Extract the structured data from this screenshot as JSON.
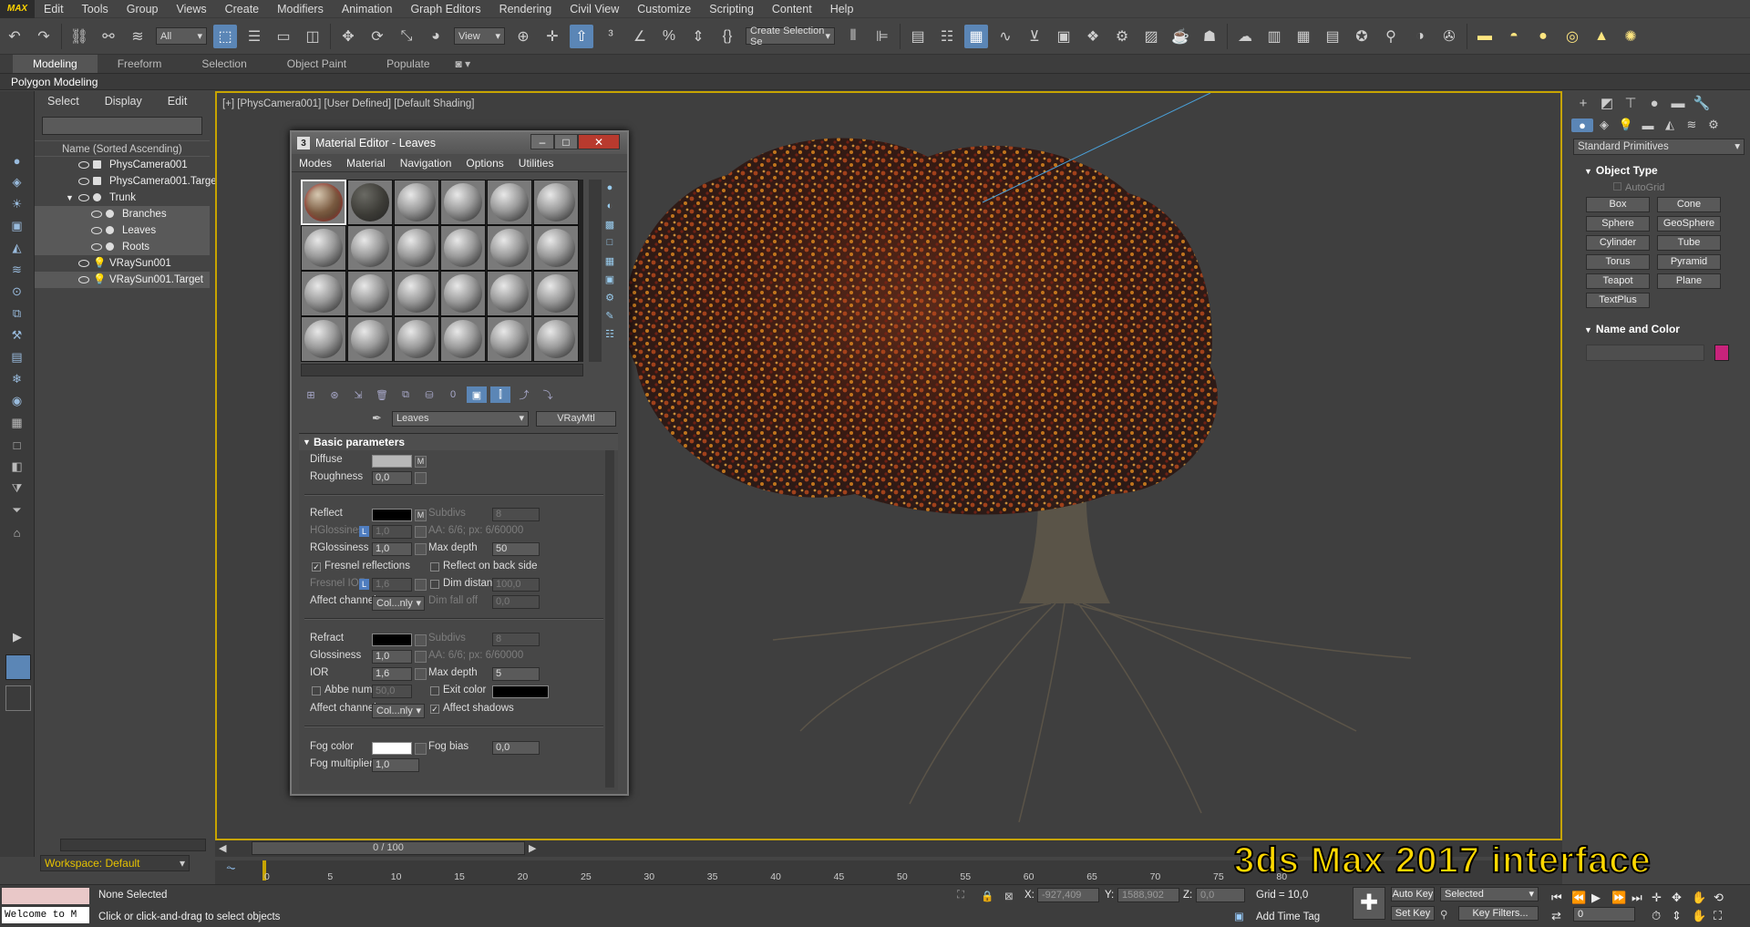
{
  "menu": {
    "logo": "MAX",
    "items": [
      "Edit",
      "Tools",
      "Group",
      "Views",
      "Create",
      "Modifiers",
      "Animation",
      "Graph Editors",
      "Rendering",
      "Civil View",
      "Customize",
      "Scripting",
      "Content",
      "Help"
    ]
  },
  "toolbar": {
    "filter": "All",
    "refcoord": "View",
    "selection_set": "Create Selection Se"
  },
  "ribbon": {
    "tabs": [
      "Modeling",
      "Freeform",
      "Selection",
      "Object Paint",
      "Populate"
    ],
    "sublabel": "Polygon Modeling"
  },
  "explorer": {
    "tabs": [
      "Select",
      "Display",
      "Edit"
    ],
    "header": "Name (Sorted Ascending)",
    "rows": [
      "PhysCamera001",
      "PhysCamera001.Target",
      "Trunk",
      "Branches",
      "Leaves",
      "Roots",
      "VRaySun001",
      "VRaySun001.Target"
    ]
  },
  "viewport": {
    "label": "[+] [PhysCamera001] [User Defined] [Default Shading]"
  },
  "material_editor": {
    "title": "Material Editor - Leaves",
    "menu": [
      "Modes",
      "Material",
      "Navigation",
      "Options",
      "Utilities"
    ],
    "material_name": "Leaves",
    "material_type": "VRayMtl",
    "rollout": "Basic parameters",
    "labels": {
      "diffuse": "Diffuse",
      "roughness": "Roughness",
      "reflect": "Reflect",
      "hglossiness": "HGlossiness",
      "rglossiness": "RGlossiness",
      "fresnel": "Fresnel reflections",
      "fresnel_ior": "Fresnel IOR",
      "affect_channels": "Affect channels",
      "subdivs": "Subdivs",
      "aa": "AA: 6/6; px: 6/60000",
      "max_depth": "Max depth",
      "reflect_back": "Reflect on back side",
      "dim_distance": "Dim distance",
      "dim_falloff": "Dim fall off",
      "refract": "Refract",
      "glossiness": "Glossiness",
      "ior": "IOR",
      "abbe": "Abbe number",
      "exit_color": "Exit color",
      "affect_shadows": "Affect shadows",
      "fog_color": "Fog color",
      "fog_multiplier": "Fog multiplier",
      "fog_bias": "Fog bias",
      "m": "M",
      "l": "L"
    },
    "values": {
      "roughness": "0,0",
      "hglossiness": "1,0",
      "rglossiness": "1,0",
      "fresnel_ior": "1,6",
      "refl_subdivs": "8",
      "refl_max_depth": "50",
      "dim_distance": "100,0",
      "dim_falloff": "0,0",
      "affect_channels": "Col...nly",
      "glossiness": "1,0",
      "ior": "1,6",
      "abbe": "50,0",
      "refr_subdivs": "8",
      "refr_max_depth": "5",
      "affect_channels2": "Col...nly",
      "fog_multiplier": "1,0",
      "fog_bias": "0,0"
    },
    "colors": {
      "diffuse": "#b8b8b8",
      "reflect": "#000000",
      "refract": "#000000",
      "exit": "#000000",
      "fog": "#ffffff"
    }
  },
  "command_panel": {
    "dropdown": "Standard Primitives",
    "object_type": "Object Type",
    "autogrid": "AutoGrid",
    "buttons": [
      "Box",
      "Cone",
      "Sphere",
      "GeoSphere",
      "Cylinder",
      "Tube",
      "Torus",
      "Pyramid",
      "Teapot",
      "Plane",
      "TextPlus"
    ],
    "name_and_color": "Name and Color",
    "object_color": "#c8237b"
  },
  "bottom": {
    "workspace": "Workspace: Default",
    "frame": "0 / 100",
    "ticks": [
      "0",
      "5",
      "10",
      "15",
      "20",
      "25",
      "30",
      "35",
      "40",
      "45",
      "50",
      "55",
      "60",
      "65",
      "70",
      "75",
      "80"
    ],
    "welcome": "Welcome to M",
    "none_selected": "None Selected",
    "prompt": "Click or click-and-drag to select objects",
    "x": "-927,409",
    "y": "1588,902",
    "z": "0,0",
    "x_label": "X:",
    "y_label": "Y:",
    "z_label": "Z:",
    "grid": "Grid = 10,0",
    "add_time_tag": "Add Time Tag",
    "auto_key": "Auto Key",
    "set_key": "Set Key",
    "selected": "Selected",
    "key_filters": "Key Filters...",
    "frame_num": "0"
  },
  "watermark": "3ds Max 2017 interface"
}
